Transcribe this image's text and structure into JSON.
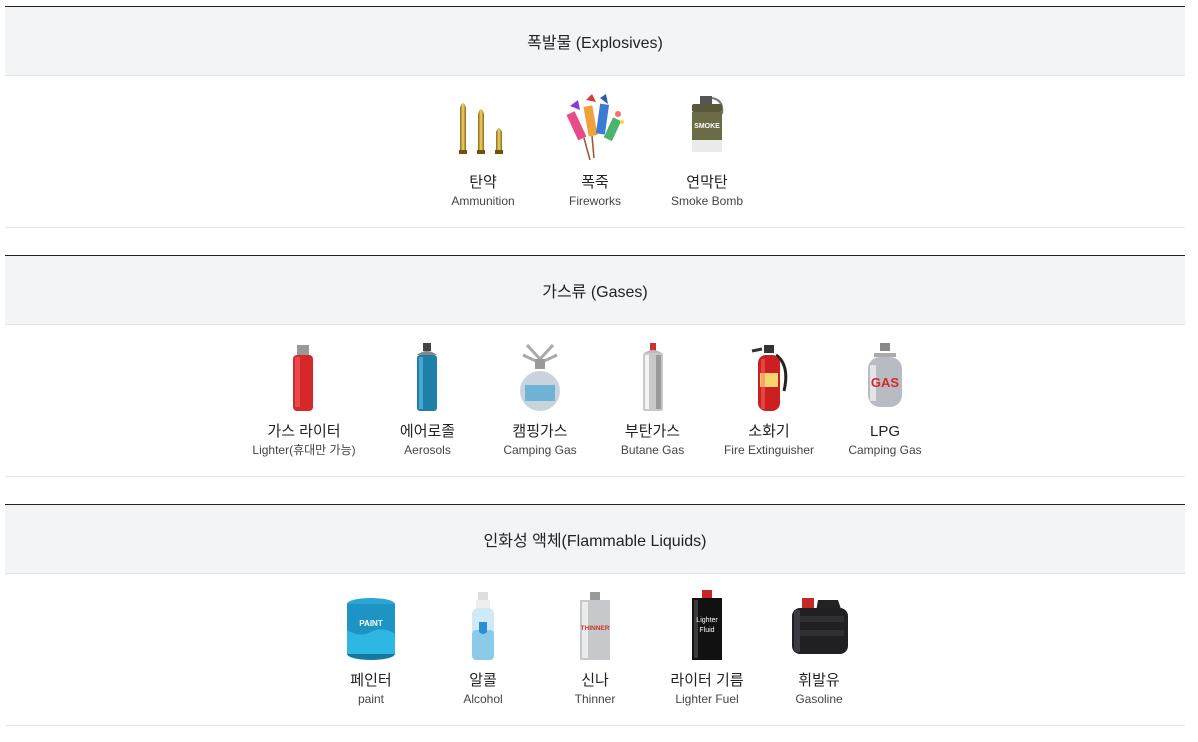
{
  "sections": [
    {
      "title": "폭발물 (Explosives)",
      "items": [
        {
          "ko": "탄약",
          "en": "Ammunition",
          "icon": "ammunition-icon"
        },
        {
          "ko": "폭죽",
          "en": "Fireworks",
          "icon": "fireworks-icon"
        },
        {
          "ko": "연막탄",
          "en": "Smoke Bomb",
          "icon": "smoke-bomb-icon"
        }
      ]
    },
    {
      "title": "가스류 (Gases)",
      "items": [
        {
          "ko": "가스 라이터",
          "en": "Lighter(휴대만 가능)",
          "icon": "lighter-icon"
        },
        {
          "ko": "에어로졸",
          "en": "Aerosols",
          "icon": "aerosol-icon"
        },
        {
          "ko": "캠핑가스",
          "en": "Camping Gas",
          "icon": "camping-gas-icon"
        },
        {
          "ko": "부탄가스",
          "en": "Butane Gas",
          "icon": "butane-gas-icon"
        },
        {
          "ko": "소화기",
          "en": "Fire Extinguisher",
          "icon": "fire-extinguisher-icon"
        },
        {
          "ko": "LPG",
          "en": "Camping Gas",
          "icon": "lpg-tank-icon"
        }
      ]
    },
    {
      "title": "인화성 액체(Flammable Liquids)",
      "items": [
        {
          "ko": "페인터",
          "en": "paint",
          "icon": "paint-can-icon",
          "label": "PAINT"
        },
        {
          "ko": "알콜",
          "en": "Alcohol",
          "icon": "alcohol-spray-icon"
        },
        {
          "ko": "신나",
          "en": "Thinner",
          "icon": "thinner-can-icon",
          "label": "THINNER"
        },
        {
          "ko": "라이터 기름",
          "en": "Lighter Fuel",
          "icon": "lighter-fuel-icon",
          "label1": "Lighter",
          "label2": "Fluid"
        },
        {
          "ko": "휘발유",
          "en": "Gasoline",
          "icon": "gasoline-can-icon"
        }
      ]
    }
  ],
  "smoke_label": "SMOKE",
  "gas_label": "GAS"
}
